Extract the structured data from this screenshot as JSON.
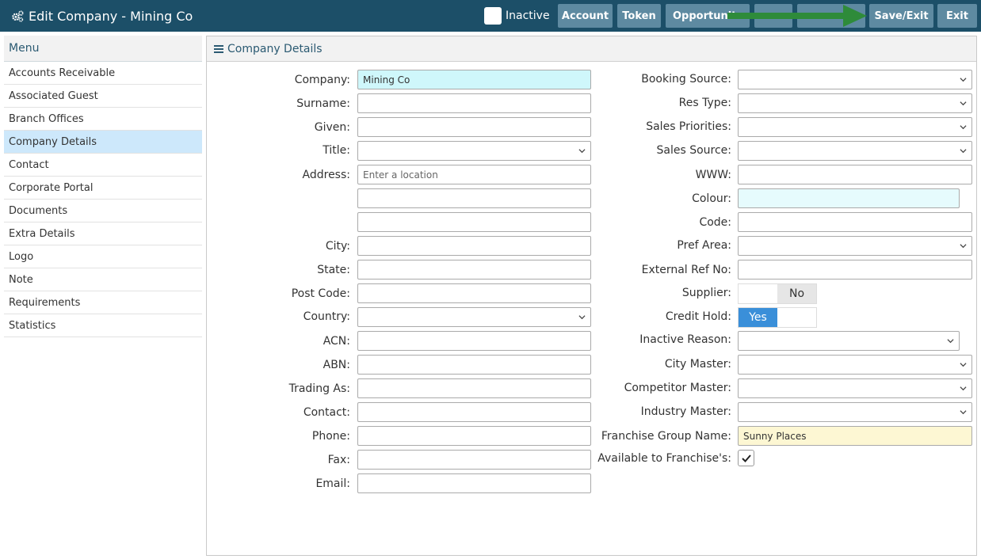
{
  "header": {
    "title": "Edit Company - Mining Co",
    "title_icon": "gears-icon",
    "inactive_label": "Inactive",
    "buttons": [
      "Account",
      "Token",
      "Opportunit",
      "",
      "",
      "Save/Exit",
      "Exit"
    ]
  },
  "menu": {
    "title": "Menu",
    "items": [
      "Accounts Receivable",
      "Associated Guest",
      "Branch Offices",
      "Company Details",
      "Contact",
      "Corporate Portal",
      "Documents",
      "Extra Details",
      "Logo",
      "Note",
      "Requirements",
      "Statistics"
    ],
    "active_index": 3
  },
  "panel": {
    "title": "Company Details"
  },
  "left_form": {
    "company": {
      "label": "Company:",
      "value": "Mining Co"
    },
    "surname": {
      "label": "Surname:",
      "value": ""
    },
    "given": {
      "label": "Given:",
      "value": ""
    },
    "title": {
      "label": "Title:",
      "value": ""
    },
    "address": {
      "label": "Address:",
      "placeholder": "Enter a location",
      "line2": "",
      "line3": ""
    },
    "city": {
      "label": "City:",
      "value": ""
    },
    "state": {
      "label": "State:",
      "value": ""
    },
    "postcode": {
      "label": "Post Code:",
      "value": ""
    },
    "country": {
      "label": "Country:",
      "value": ""
    },
    "acn": {
      "label": "ACN:",
      "value": ""
    },
    "abn": {
      "label": "ABN:",
      "value": ""
    },
    "trading_as": {
      "label": "Trading As:",
      "value": ""
    },
    "contact": {
      "label": "Contact:",
      "value": ""
    },
    "phone": {
      "label": "Phone:",
      "value": ""
    },
    "fax": {
      "label": "Fax:",
      "value": ""
    },
    "email": {
      "label": "Email:",
      "value": ""
    }
  },
  "right_form": {
    "booking_source": {
      "label": "Booking Source:",
      "value": ""
    },
    "res_type": {
      "label": "Res Type:",
      "value": ""
    },
    "sales_priorities": {
      "label": "Sales Priorities:",
      "value": ""
    },
    "sales_source": {
      "label": "Sales Source:",
      "value": ""
    },
    "www": {
      "label": "WWW:",
      "value": ""
    },
    "colour": {
      "label": "Colour:",
      "value": ""
    },
    "code": {
      "label": "Code:",
      "value": ""
    },
    "pref_area": {
      "label": "Pref Area:",
      "value": ""
    },
    "external_ref": {
      "label": "External Ref No:",
      "value": ""
    },
    "supplier": {
      "label": "Supplier:",
      "state": "No"
    },
    "credit_hold": {
      "label": "Credit Hold:",
      "state": "Yes"
    },
    "inactive_reason": {
      "label": "Inactive Reason:",
      "value": ""
    },
    "city_master": {
      "label": "City Master:",
      "value": ""
    },
    "competitor_master": {
      "label": "Competitor Master:",
      "value": ""
    },
    "industry_master": {
      "label": "Industry Master:",
      "value": ""
    },
    "franchise_group": {
      "label": "Franchise Group Name:",
      "value": "Sunny Places"
    },
    "available_franchise": {
      "label": "Available to Franchise's:",
      "checked": true
    }
  },
  "colors": {
    "header_bg": "#1c4f68",
    "header_button": "#5e8aa1",
    "menu_active": "#cde8fb",
    "highlight_cyan": "#cff7fb",
    "highlight_yellow": "#fdf7d3",
    "toggle_on": "#3a8fd9",
    "arrow": "#2e8b3a"
  }
}
